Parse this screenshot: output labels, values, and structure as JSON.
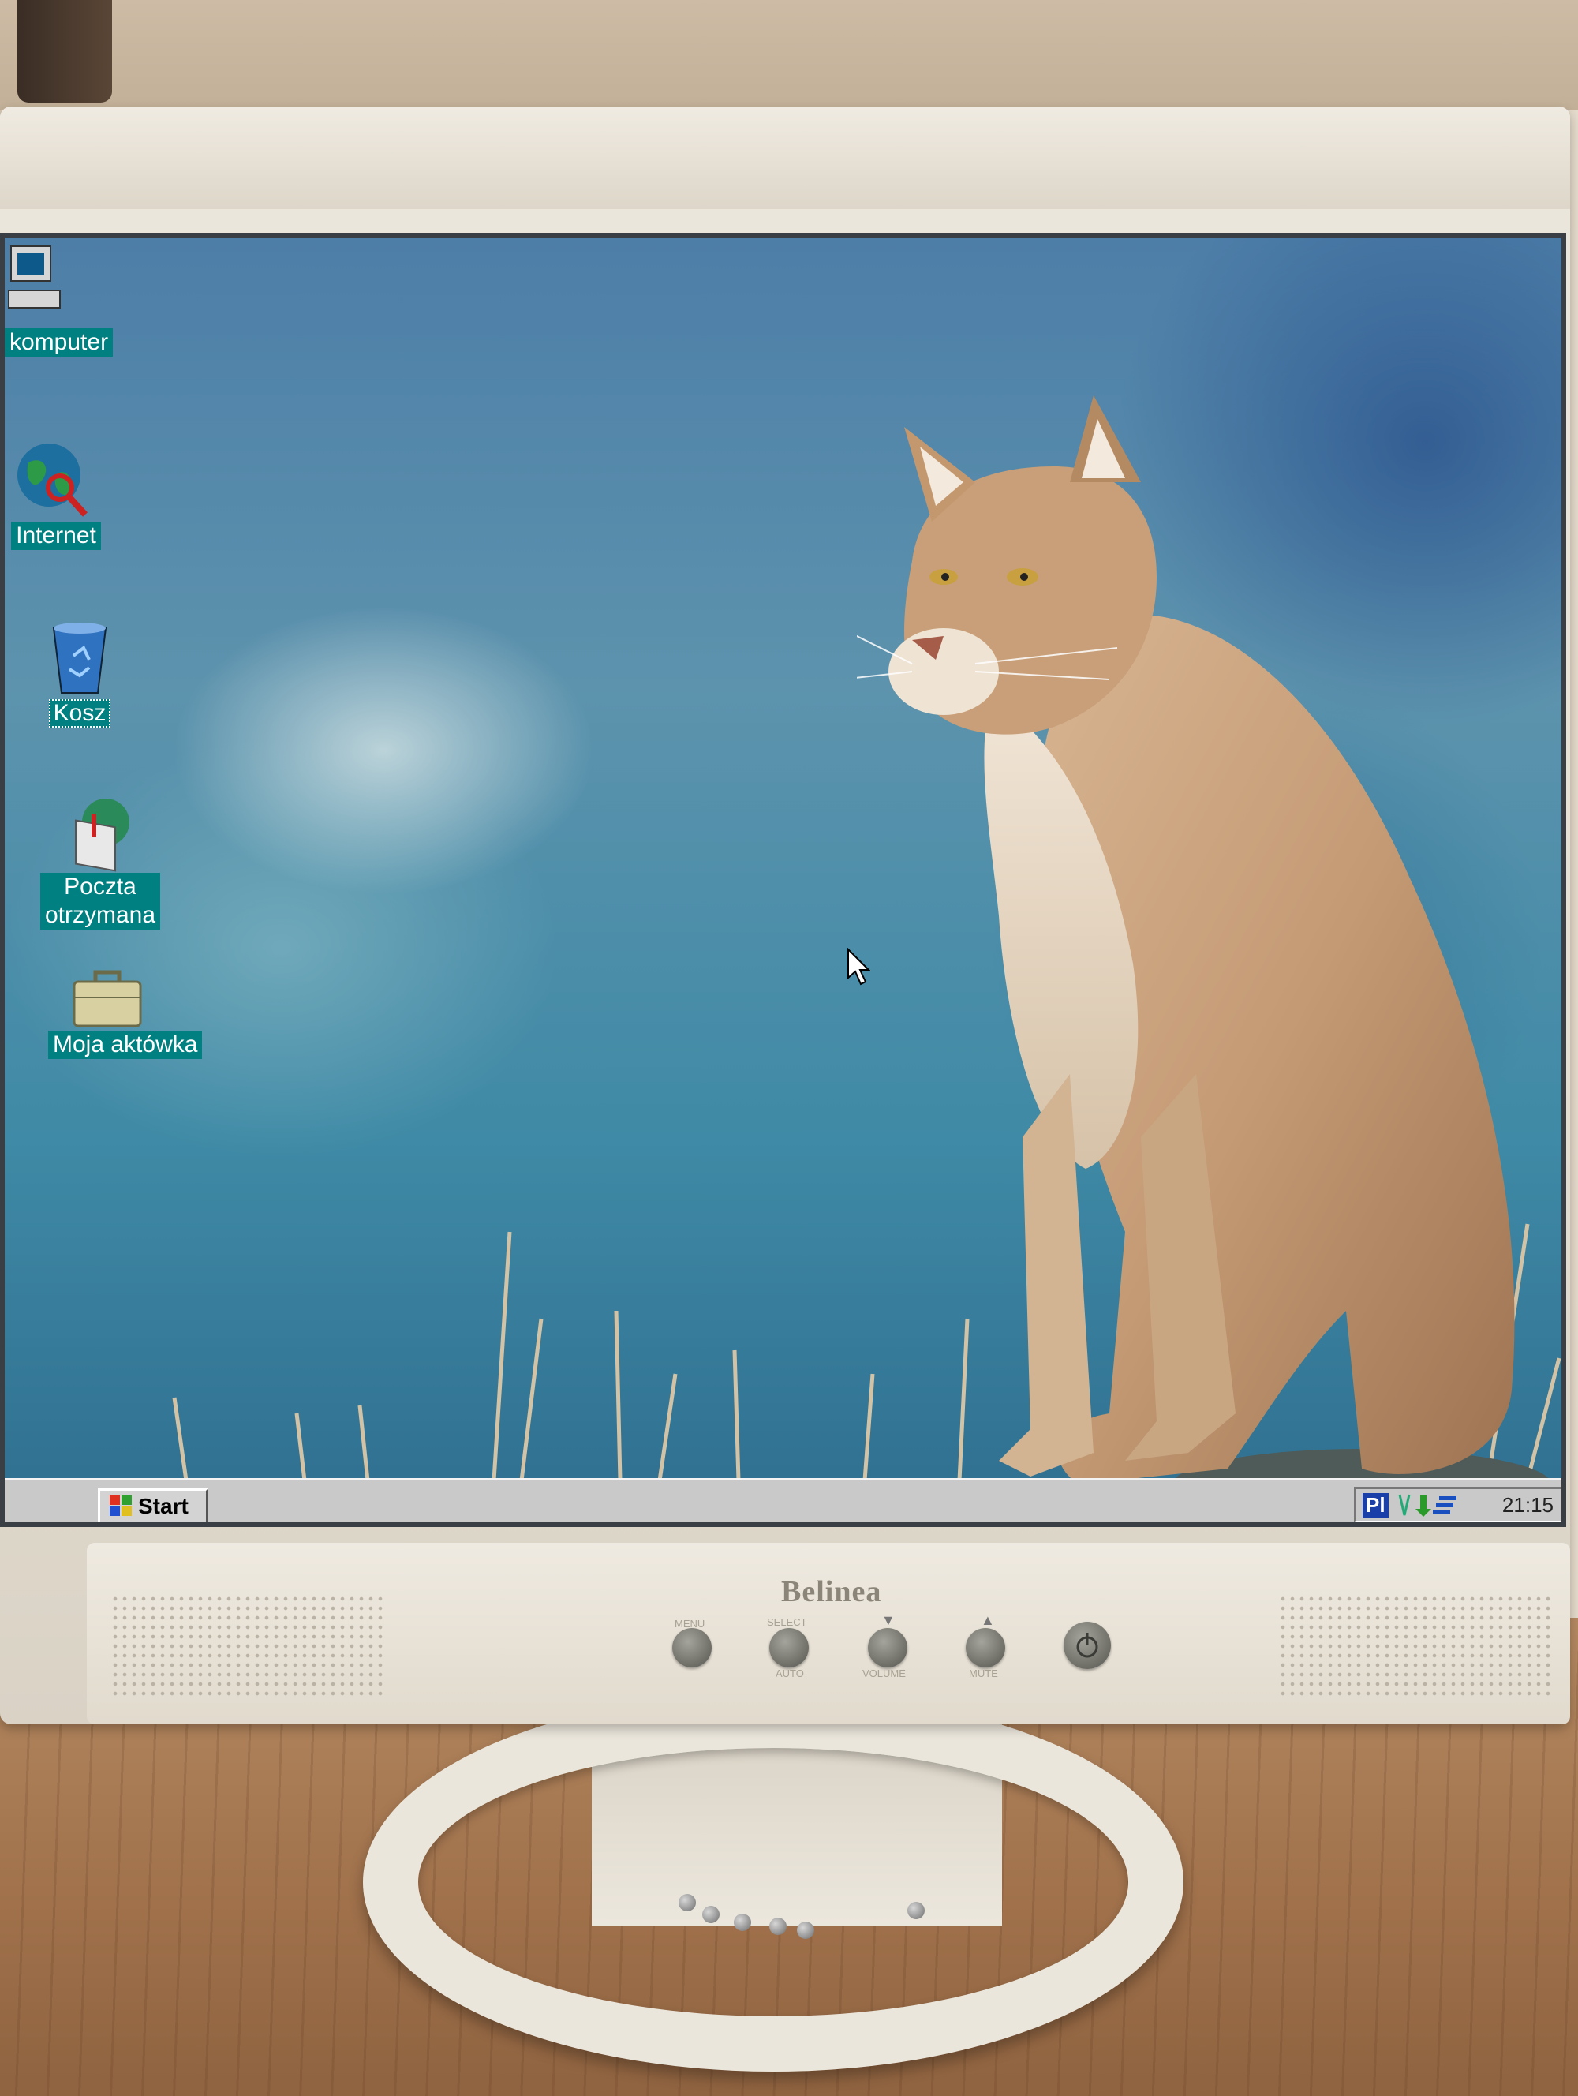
{
  "desktop": {
    "icons": [
      {
        "label": "komputer"
      },
      {
        "label": "Internet"
      },
      {
        "label": "Kosz"
      },
      {
        "label": "Poczta otrzymana"
      },
      {
        "label": "Moja aktówka"
      }
    ]
  },
  "taskbar": {
    "start_label": "Start",
    "tray": {
      "language": "Pl",
      "clock": "21:15"
    }
  },
  "monitor": {
    "brand": "Belinea",
    "buttons": [
      "MENU",
      "SELECT",
      "▼",
      "▲",
      ""
    ],
    "sub_labels": [
      "AUTO",
      "VOLUME",
      "MUTE"
    ]
  },
  "colors": {
    "icon_label_bg": "#008080",
    "taskbar": "#c9c9c9",
    "bezel": "#ece7dd"
  },
  "icons": [
    "computer-icon",
    "internet-globe-icon",
    "recycle-bin-icon",
    "inbox-icon",
    "briefcase-icon",
    "windows-logo-icon",
    "power-icon",
    "mouse-cursor-icon"
  ]
}
